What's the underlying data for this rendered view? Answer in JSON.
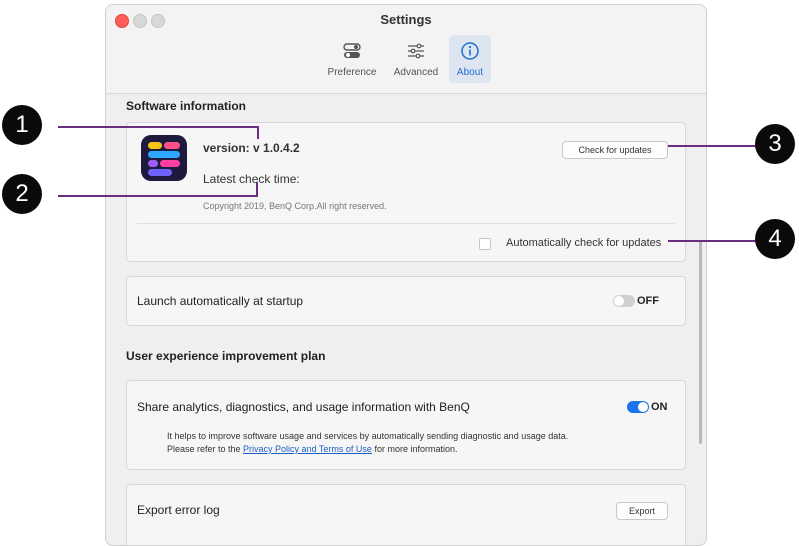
{
  "window": {
    "title": "Settings",
    "tabs": [
      {
        "label": "Preference",
        "icon": "toggles-icon"
      },
      {
        "label": "Advanced",
        "icon": "sliders-icon"
      },
      {
        "label": "About",
        "icon": "info-icon",
        "active": true
      }
    ]
  },
  "software_info": {
    "section_title": "Software information",
    "version": "version: v 1.0.4.2",
    "latest_check": "Latest check time:",
    "copyright": "Copyright  2019, BenQ Corp.All right reserved.",
    "check_button": "Check for updates",
    "auto_check_label": "Automatically check for updates",
    "auto_check_checked": false
  },
  "startup": {
    "label": "Launch automatically at startup",
    "toggle_state": "OFF"
  },
  "ux_plan": {
    "section_title": "User experience improvement plan",
    "share_label": "Share analytics, diagnostics, and usage information with BenQ",
    "toggle_state": "ON",
    "desc_line1": "It helps to improve software usage and services by automatically sending diagnostic and usage data.",
    "desc_line2_prefix": "Please refer to the ",
    "desc_link": "Privacy Policy and Terms of Use",
    "desc_line2_suffix": " for more information."
  },
  "export": {
    "label": "Export error log",
    "button": "Export"
  },
  "callouts": [
    "1",
    "2",
    "3",
    "4"
  ],
  "colors": {
    "accent": "#1f6fcf",
    "callout_line": "#6b2d7e",
    "toggle_on": "#1a73e8",
    "toggle_off": "#d0d0d0"
  }
}
